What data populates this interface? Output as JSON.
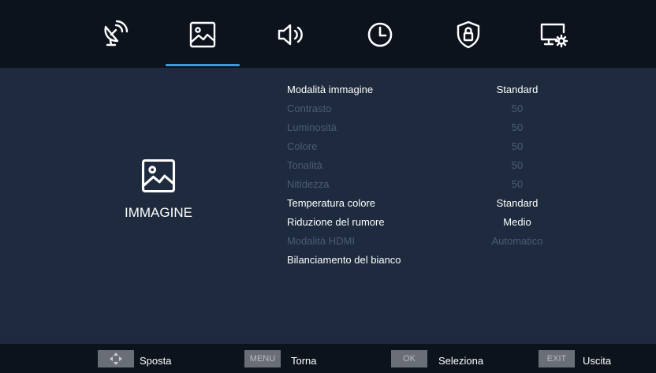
{
  "tabs": [
    {
      "icon": "satellite-icon",
      "active": false
    },
    {
      "icon": "picture-icon",
      "active": true
    },
    {
      "icon": "speaker-icon",
      "active": false
    },
    {
      "icon": "clock-icon",
      "active": false
    },
    {
      "icon": "lock-shield-icon",
      "active": false
    },
    {
      "icon": "monitor-gear-icon",
      "active": false
    }
  ],
  "section": {
    "icon": "picture-icon",
    "title": "IMMAGINE"
  },
  "menu": [
    {
      "label": "Modalità immagine",
      "value": "Standard",
      "enabled": true
    },
    {
      "label": "Contrasto",
      "value": "50",
      "enabled": false
    },
    {
      "label": "Luminosità",
      "value": "50",
      "enabled": false
    },
    {
      "label": "Colore",
      "value": "50",
      "enabled": false
    },
    {
      "label": "Tonalità",
      "value": "50",
      "enabled": false
    },
    {
      "label": "Nitidezza",
      "value": "50",
      "enabled": false
    },
    {
      "label": "Temperatura colore",
      "value": "Standard",
      "enabled": true
    },
    {
      "label": "Riduzione del rumore",
      "value": "Medio",
      "enabled": true
    },
    {
      "label": "Modalità HDMI",
      "value": "Automatico",
      "enabled": false
    },
    {
      "label": "Bilanciamento del bianco",
      "value": "",
      "enabled": true
    }
  ],
  "footer": {
    "move": {
      "key_icon": "arrows-icon",
      "label": "Sposta"
    },
    "back": {
      "key": "MENU",
      "label": "Torna"
    },
    "select": {
      "key": "OK",
      "label": "Seleziona"
    },
    "exit": {
      "key": "EXIT",
      "label": "Uscita"
    }
  },
  "colors": {
    "accent": "#3a9bd6",
    "background": "#1e2b3e",
    "bar": "#0d131d",
    "disabled_text": "#4e5c70"
  }
}
